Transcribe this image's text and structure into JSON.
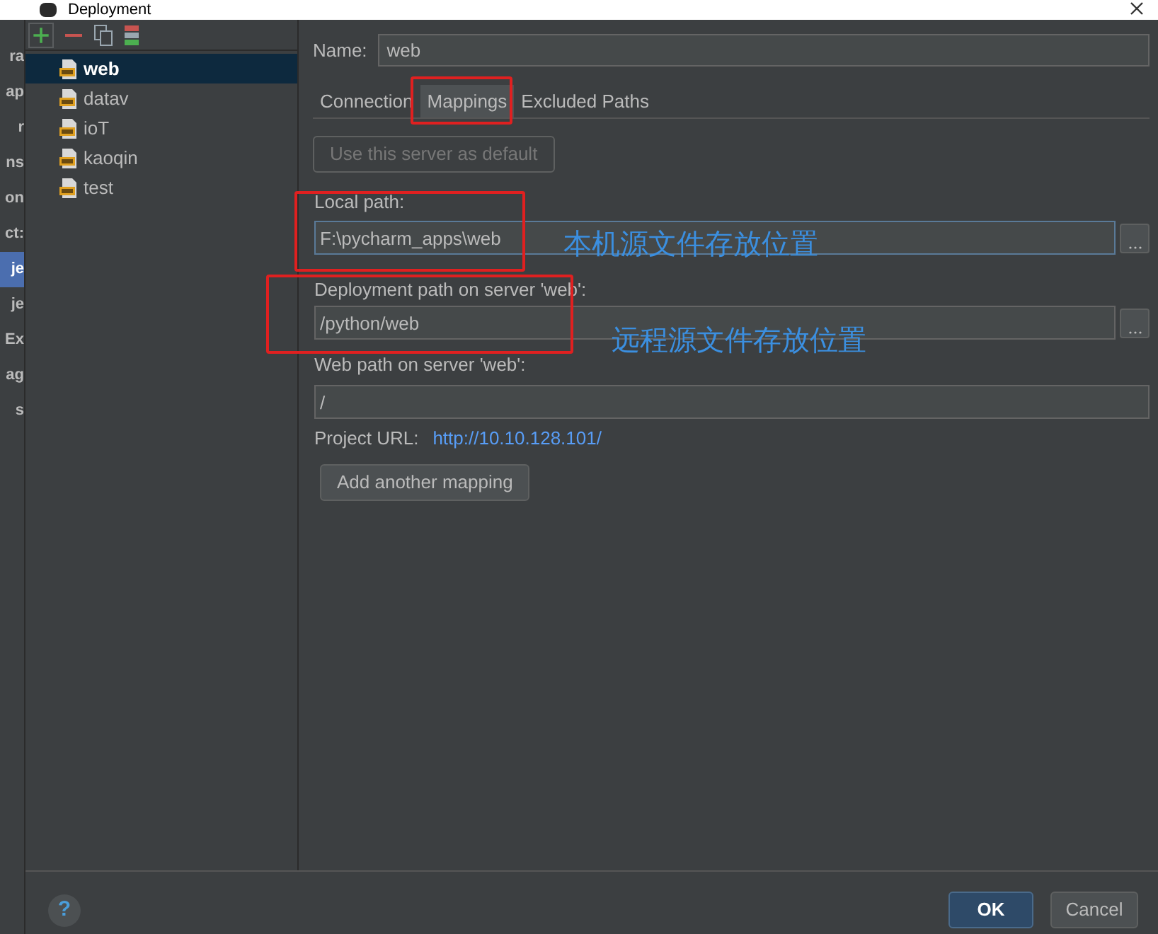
{
  "window": {
    "title": "Deployment"
  },
  "behind_panel": {
    "items": [
      {
        "label": "ra",
        "selected": false
      },
      {
        "label": "ap",
        "selected": false
      },
      {
        "label": "r",
        "selected": false
      },
      {
        "label": "ns",
        "selected": false
      },
      {
        "label": "on",
        "selected": false
      },
      {
        "label": "ct:",
        "selected": false
      },
      {
        "label": "je",
        "selected": true
      },
      {
        "label": "je",
        "selected": false
      },
      {
        "label": "Ex",
        "selected": false
      },
      {
        "label": "ag",
        "selected": false
      },
      {
        "label": "s",
        "selected": false
      }
    ]
  },
  "servers": [
    {
      "name": "web",
      "selected": true
    },
    {
      "name": "datav",
      "selected": false
    },
    {
      "name": "ioT",
      "selected": false
    },
    {
      "name": "kaoqin",
      "selected": false
    },
    {
      "name": "test",
      "selected": false
    }
  ],
  "name_field": {
    "label": "Name:",
    "value": "web"
  },
  "tabs": [
    {
      "label": "Connection",
      "selected": false
    },
    {
      "label": "Mappings",
      "selected": true
    },
    {
      "label": "Excluded Paths",
      "selected": false
    }
  ],
  "default_button": {
    "label": "Use this server as default",
    "disabled": true
  },
  "mapping": {
    "local_path": {
      "label": "Local path:",
      "value": "F:\\pycharm_apps\\web"
    },
    "deployment_path": {
      "label": "Deployment path on server 'web':",
      "value": "/python/web"
    },
    "web_path": {
      "label": "Web path on server 'web':",
      "value": "/"
    },
    "project_url": {
      "label": "Project URL:",
      "value": "http://10.10.128.101/"
    },
    "add_button": "Add another mapping"
  },
  "annotations": [
    {
      "text": "本机源文件存放位置"
    },
    {
      "text": "远程源文件存放位置"
    }
  ],
  "footer": {
    "ok": "OK",
    "cancel": "Cancel",
    "help": "?"
  }
}
